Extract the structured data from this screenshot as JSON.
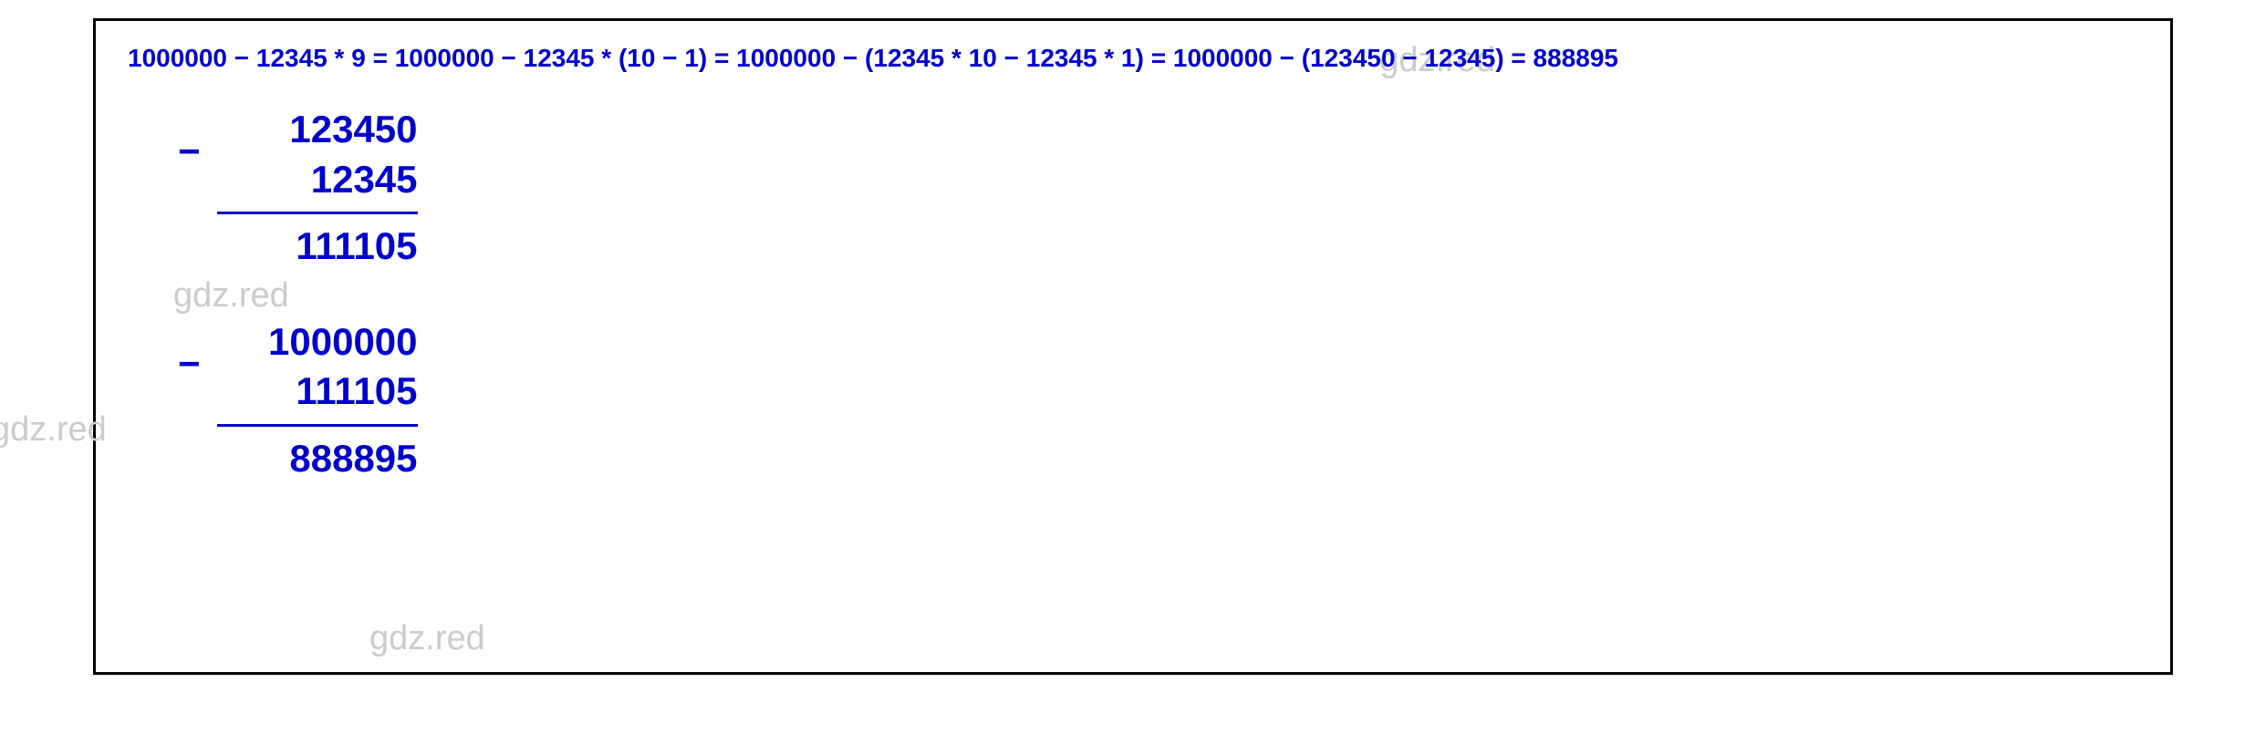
{
  "equation": "1000000 − 12345 * 9 = 1000000 − 12345 * (10 − 1) = 1000000 − (12345 * 10 − 12345 * 1) = 1000000 − (123450 − 12345) = 888895",
  "calc1": {
    "top": "123450",
    "bottom": "12345",
    "result": "111105"
  },
  "calc2": {
    "top": "1000000",
    "bottom": "111105",
    "result": "888895"
  },
  "watermark": "gdz.red"
}
